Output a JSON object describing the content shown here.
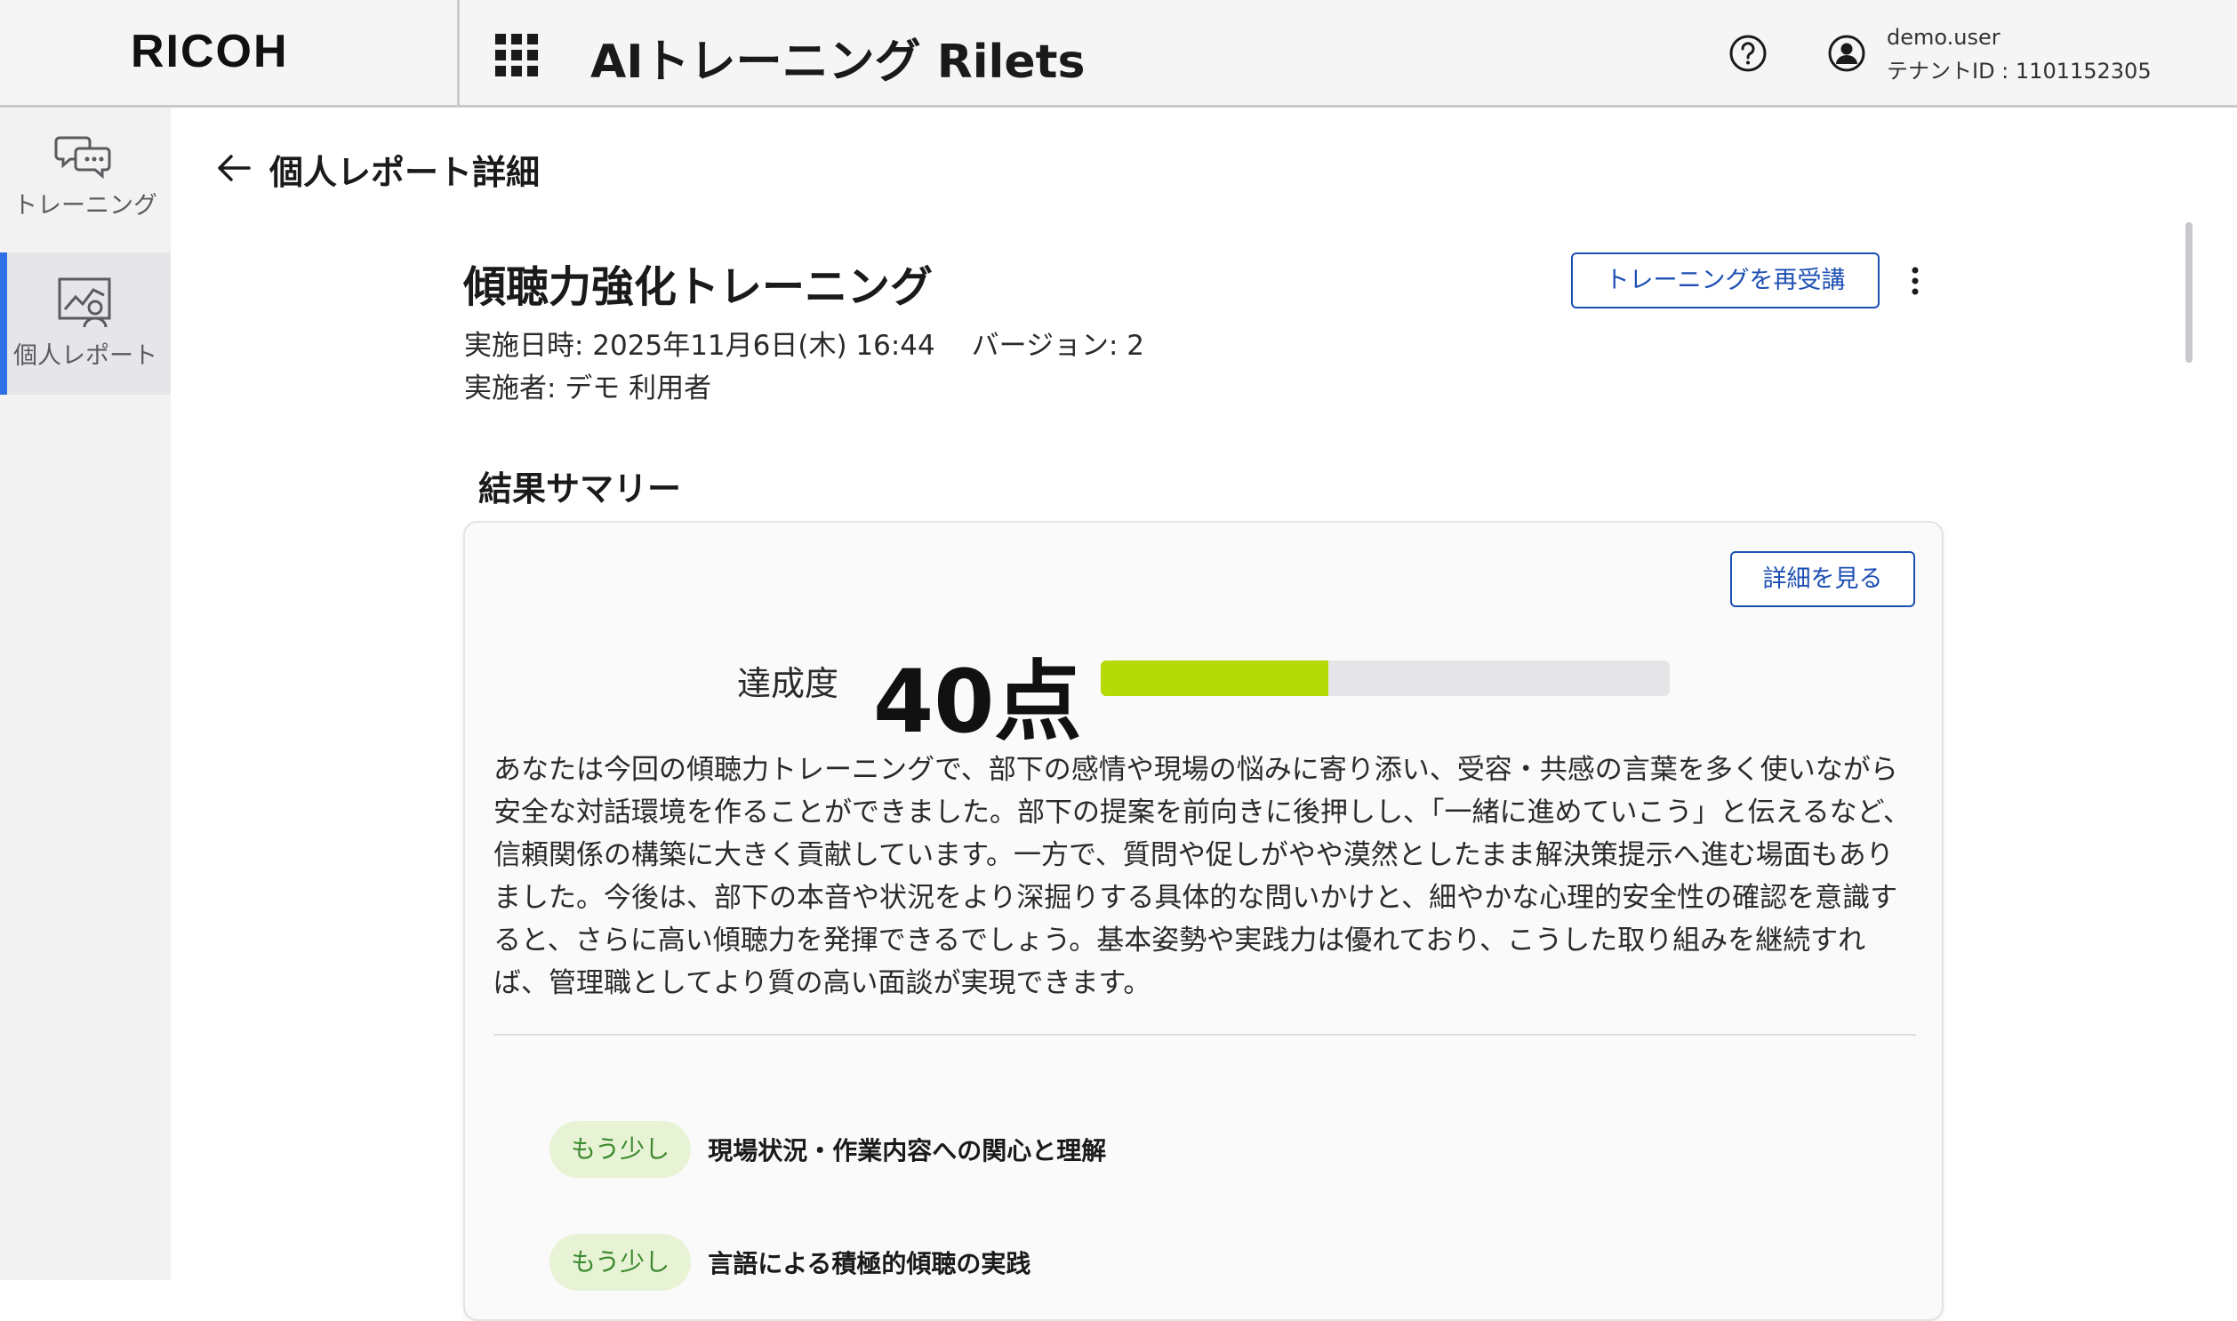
{
  "header": {
    "brand": "RICOH",
    "app_title": "AIトレーニング Rilets",
    "user_name": "demo.user",
    "tenant_id": "テナントID : 1101152305"
  },
  "sidebar": {
    "items": [
      {
        "label": "トレーニング",
        "icon": "chat-bubbles-icon",
        "active": false
      },
      {
        "label": "個人レポート",
        "icon": "report-person-icon",
        "active": true
      }
    ],
    "active_color": "#2f6fe4"
  },
  "page": {
    "title": "個人レポート詳細"
  },
  "report": {
    "course_title": "傾聴力強化トレーニング",
    "date_line": "実施日時: 2025年11月6日(木) 16:44　 バージョン: 2",
    "author_line": "実施者: デモ 利用者",
    "retake_label": "トレーニングを再受講"
  },
  "summary": {
    "heading": "結果サマリー",
    "detail_label": "詳細を見る",
    "score_label": "達成度",
    "score_text": "40点",
    "score_value": 40,
    "score_max": 100,
    "bar_color": "#b5da06",
    "body": "あなたは今回の傾聴力トレーニングで、部下の感情や現場の悩みに寄り添い、受容・共感の言葉を多く使いながら安全な対話環境を作ることができました。部下の提案を前向きに後押しし、「一緒に進めていこう」と伝えるなど、信頼関係の構築に大きく貢献しています。一方で、質問や促しがやや漠然としたまま解決策提示へ進む場面もありました。今後は、部下の本音や状況をより深掘りする具体的な問いかけと、細やかな心理的安全性の確認を意識すると、さらに高い傾聴力を発揮できるでしょう。基本姿勢や実践力は優れており、こうした取り組みを継続すれば、管理職としてより質の高い面談が実現できます。",
    "evaluations": [
      {
        "badge": "もう少し",
        "text": "現場状況・作業内容への関心と理解"
      },
      {
        "badge": "もう少し",
        "text": "言語による積極的傾聴の実践"
      }
    ]
  }
}
